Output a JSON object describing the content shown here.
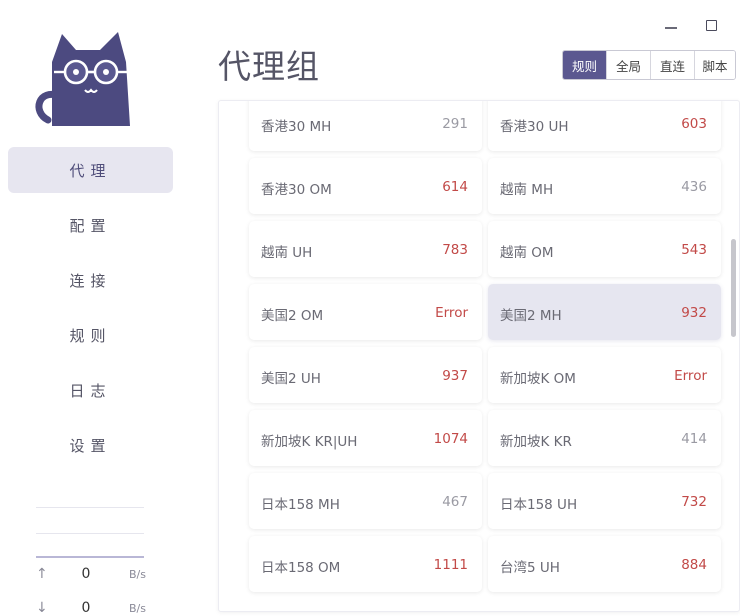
{
  "window": {
    "minimize_icon": "minimize-icon",
    "maximize_icon": "maximize-icon"
  },
  "sidebar": {
    "logo_icon": "cat-logo-icon",
    "items": [
      {
        "label": "代理",
        "active": true
      },
      {
        "label": "配置",
        "active": false
      },
      {
        "label": "连接",
        "active": false
      },
      {
        "label": "规则",
        "active": false
      },
      {
        "label": "日志",
        "active": false
      },
      {
        "label": "设置",
        "active": false
      }
    ],
    "traffic": {
      "upload": {
        "icon": "arrow-up-icon",
        "value": "0",
        "unit": "B/s"
      },
      "download": {
        "icon": "arrow-down-icon",
        "value": "0",
        "unit": "B/s"
      }
    }
  },
  "main": {
    "title": "代理组",
    "modes": [
      {
        "label": "规则",
        "active": true
      },
      {
        "label": "全局",
        "active": false
      },
      {
        "label": "直连",
        "active": false
      },
      {
        "label": "脚本",
        "active": false
      }
    ],
    "proxies": [
      {
        "name": "香港30 MH",
        "delay": "291",
        "delay_color": "gray",
        "selected": false
      },
      {
        "name": "香港30 UH",
        "delay": "603",
        "delay_color": "red",
        "selected": false
      },
      {
        "name": "香港30 OM",
        "delay": "614",
        "delay_color": "red",
        "selected": false
      },
      {
        "name": "越南 MH",
        "delay": "436",
        "delay_color": "gray",
        "selected": false
      },
      {
        "name": "越南 UH",
        "delay": "783",
        "delay_color": "red",
        "selected": false
      },
      {
        "name": "越南 OM",
        "delay": "543",
        "delay_color": "red",
        "selected": false
      },
      {
        "name": "美国2 OM",
        "delay": "Error",
        "delay_color": "red",
        "selected": false
      },
      {
        "name": "美国2 MH",
        "delay": "932",
        "delay_color": "red",
        "selected": true
      },
      {
        "name": "美国2 UH",
        "delay": "937",
        "delay_color": "red",
        "selected": false
      },
      {
        "name": "新加坡K OM",
        "delay": "Error",
        "delay_color": "red",
        "selected": false
      },
      {
        "name": "新加坡K KR|UH",
        "delay": "1074",
        "delay_color": "red",
        "selected": false
      },
      {
        "name": "新加坡K KR",
        "delay": "414",
        "delay_color": "gray",
        "selected": false
      },
      {
        "name": "日本158 MH",
        "delay": "467",
        "delay_color": "gray",
        "selected": false
      },
      {
        "name": "日本158 UH",
        "delay": "732",
        "delay_color": "red",
        "selected": false
      },
      {
        "name": "日本158 OM",
        "delay": "1111",
        "delay_color": "red",
        "selected": false
      },
      {
        "name": "台湾5 UH",
        "delay": "884",
        "delay_color": "red",
        "selected": false
      }
    ]
  },
  "colors": {
    "accent": "#5b5890",
    "nav_active_bg": "#e7e6f0",
    "selected_card_bg": "#e6e6f0",
    "delay_red": "#c24a48",
    "delay_gray": "#9a9aa3"
  }
}
